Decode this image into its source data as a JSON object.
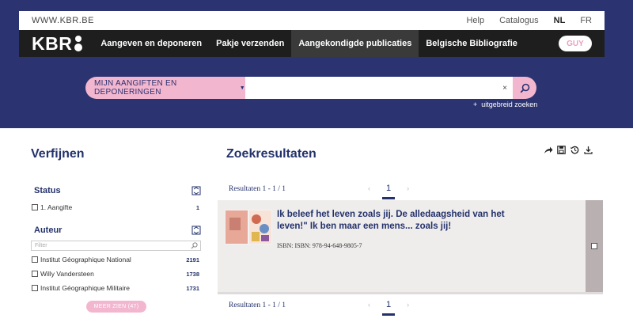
{
  "header": {
    "site_name": "WWW.KBR.BE",
    "links": [
      {
        "label": "Help"
      },
      {
        "label": "Catalogus"
      },
      {
        "label": "NL",
        "active": true
      },
      {
        "label": "FR"
      }
    ],
    "logo_text": "KBR",
    "nav": [
      {
        "label": "Aangeven en deponeren"
      },
      {
        "label": "Pakje verzenden"
      },
      {
        "label": "Aangekondigde publicaties",
        "active": true
      },
      {
        "label": "Belgische Bibliografie"
      }
    ],
    "user_label": "GUY"
  },
  "search": {
    "scope_label": "MIJN AANGIFTEN EN DEPONERINGEN",
    "query": "",
    "clear_label": "×",
    "advanced_label": "uitgebreid zoeken"
  },
  "sidebar": {
    "title": "Verfijnen",
    "facets": [
      {
        "label": "Status",
        "items": [
          {
            "label": "1. Aangifte",
            "count": "1"
          }
        ]
      },
      {
        "label": "Auteur",
        "filter_placeholder": "Filter",
        "items": [
          {
            "label": "Institut Géographique National",
            "count": "2191"
          },
          {
            "label": "Willy Vandersteen",
            "count": "1738"
          },
          {
            "label": "Institut Géographique Militaire",
            "count": "1731"
          }
        ]
      }
    ],
    "more_label": "MEER ZIEN (47)"
  },
  "results": {
    "title": "Zoekresultaten",
    "count_label": "Resultaten 1 - 1 / 1",
    "pager": {
      "prev": "‹",
      "page": "1",
      "next": "›"
    },
    "items": [
      {
        "title": "Ik beleef het leven zoals jij. De alledaagsheid van het leven!\" Ik ben maar een mens... zoals jij!",
        "isbn": "ISBN: ISBN: 978-94-648-9805-7"
      }
    ]
  },
  "colors": {
    "navy": "#2b3370",
    "pink": "#f3b6cf",
    "nav_black": "#1e1e1e"
  }
}
